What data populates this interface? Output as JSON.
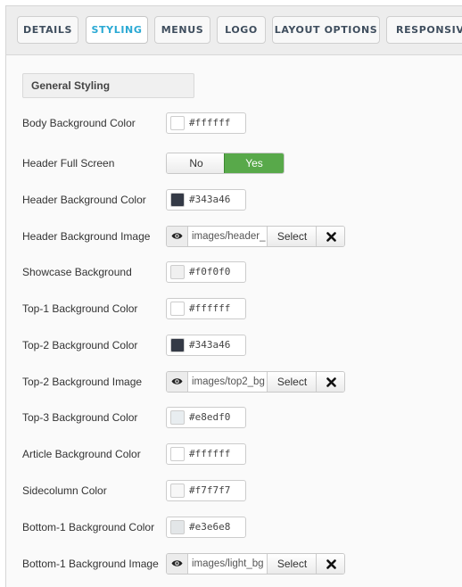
{
  "tabs": [
    {
      "label": "DETAILS",
      "active": false
    },
    {
      "label": "STYLING",
      "active": true
    },
    {
      "label": "MENUS",
      "active": false
    },
    {
      "label": "LOGO",
      "active": false
    },
    {
      "label": "LAYOUT OPTIONS",
      "active": false
    },
    {
      "label": "RESPONSIVE",
      "active": false
    }
  ],
  "section": {
    "title": "General Styling"
  },
  "fields": [
    {
      "label": "Body Background Color",
      "type": "color",
      "value": "#ffffff"
    },
    {
      "label": "Header Full Screen",
      "type": "toggle",
      "off_label": "No",
      "on_label": "Yes",
      "value": "Yes"
    },
    {
      "label": "Header Background Color",
      "type": "color",
      "value": "#343a46"
    },
    {
      "label": "Header Background Image",
      "type": "media",
      "value": "images/header_",
      "select_label": "Select"
    },
    {
      "label": "Showcase Background",
      "type": "color",
      "value": "#f0f0f0"
    },
    {
      "label": "Top-1 Background Color",
      "type": "color",
      "value": "#ffffff"
    },
    {
      "label": "Top-2 Background Color",
      "type": "color",
      "value": "#343a46"
    },
    {
      "label": "Top-2 Background Image",
      "type": "media",
      "value": "images/top2_bg",
      "select_label": "Select"
    },
    {
      "label": "Top-3 Background Color",
      "type": "color",
      "value": "#e8edf0"
    },
    {
      "label": "Article Background Color",
      "type": "color",
      "value": "#ffffff"
    },
    {
      "label": "Sidecolumn Color",
      "type": "color",
      "value": "#f7f7f7"
    },
    {
      "label": "Bottom-1 Background Color",
      "type": "color",
      "value": "#e3e6e8"
    },
    {
      "label": "Bottom-1 Background Image",
      "type": "media",
      "value": "images/light_bg",
      "select_label": "Select"
    }
  ],
  "icons": {
    "preview": "eye-icon",
    "clear": "close-x-icon"
  },
  "colors": {
    "accent_tab": "#2aa9d4",
    "toggle_on": "#58a94a"
  }
}
